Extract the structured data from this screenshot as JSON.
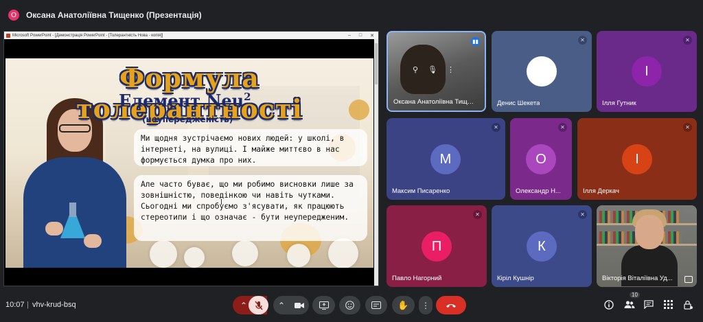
{
  "header": {
    "avatar_letter": "О",
    "title": "Оксана Анатоліївна Тищенко (Презентація)"
  },
  "presentation_window": {
    "titlebar": "Microsoft PowerPoint - [Демонстрація PowerPoint - [Толерантність Нова - копія]]",
    "slide": {
      "title": "Формула толерантності",
      "element": "Елемент Neu",
      "element_sup": "2",
      "subtitle": "(неупередженість)",
      "bubble1": "Ми щодня зустрічаємо нових людей: у школі, в інтернеті, на вулиці. І майже миттєво в нас формується думка про них.",
      "bubble2": "Але часто буває, що ми робимо висновки лише за зовнішністю, поведінкою чи навіть чутками. Сьогодні ми спробуємо з'ясувати, як працюють стереотипи і що означає - бути неупередженим."
    }
  },
  "participants": [
    {
      "name": "Оксана Анатоліївна Тищенко",
      "type": "camera",
      "mic": "speaking"
    },
    {
      "name": "Денис Шекета",
      "letter": "",
      "color": "#4a5d87",
      "avatar_color": "#ffffff",
      "mic": "muted"
    },
    {
      "name": "Ілля Гутник",
      "letter": "І",
      "color": "#6a2a8a",
      "avatar_color": "#8e24aa",
      "mic": "muted"
    },
    {
      "name": "Максим Писаренко",
      "letter": "М",
      "color": "#3b4384",
      "avatar_color": "#5c6bc0",
      "mic": "muted"
    },
    {
      "name": "Олександр Н...",
      "letter": "О",
      "color": "#7b2a8c",
      "avatar_color": "#ab47bc",
      "mic": "muted"
    },
    {
      "name": "Ілля Деркач",
      "letter": "І",
      "color": "#8a2e18",
      "avatar_color": "#d84315",
      "mic": "muted"
    },
    {
      "name": "Павло Нагорний",
      "letter": "П",
      "color": "#8a1f45",
      "avatar_color": "#e91e63",
      "mic": "muted"
    },
    {
      "name": "Кірiл Кушнір",
      "letter": "К",
      "color": "#3d4a8a",
      "avatar_color": "#5c6bc0",
      "mic": "muted"
    },
    {
      "name": "Вікторія Віталіївна Уд...",
      "type": "camera"
    }
  ],
  "bottombar": {
    "time": "10:07",
    "separator": "|",
    "meeting_code": "vhv-krud-bsq",
    "people_count": "10"
  },
  "icons": {
    "mic_off": "mic-off-icon",
    "camera": "camera-icon",
    "present": "present-icon",
    "emoji": "emoji-icon",
    "captions": "captions-icon",
    "hand": "raise-hand-icon",
    "more": "more-vert-icon",
    "hangup": "hangup-icon",
    "info": "info-icon",
    "people": "people-icon",
    "chat": "chat-icon",
    "activities": "apps-icon",
    "host": "host-controls-icon"
  }
}
